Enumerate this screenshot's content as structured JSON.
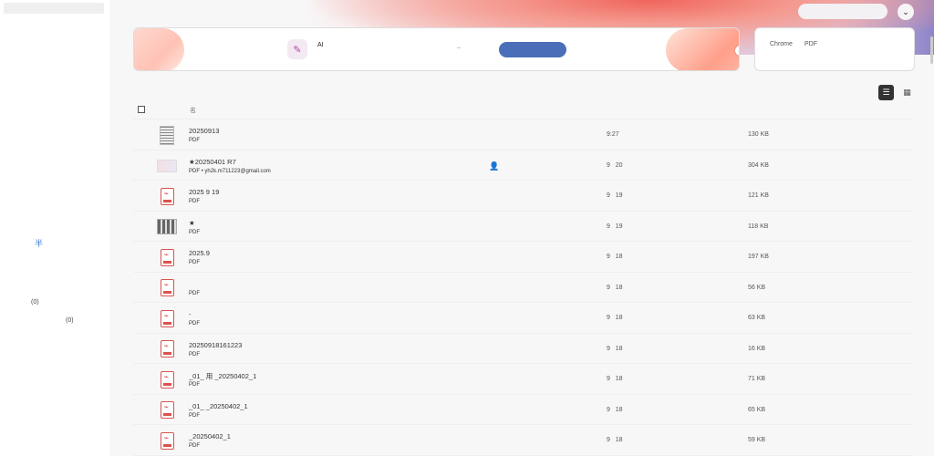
{
  "sidebar": {
    "mark": "半",
    "count1": "(0)",
    "count2": "(0)"
  },
  "header": {
    "search_placeholder": "",
    "account_icon": "chevron-down-icon"
  },
  "promo": {
    "ai_label": "AI",
    "dots": "..",
    "cta_label": "",
    "next_icon": "chevron-right-icon"
  },
  "chrome_card": {
    "label1": "Chrome",
    "label2": "PDF"
  },
  "list": {
    "name_header": "名"
  },
  "files": [
    {
      "thumb": "doc",
      "name": "20250913",
      "sub": "PDF",
      "owner": "",
      "date": "9:27",
      "size": "130 KB"
    },
    {
      "thumb": "img",
      "name": "★20250401                    R7",
      "sub": "PDF  •          yh2k.m711223@gmail.com",
      "owner": "shared",
      "date": "9   20",
      "size": "304 KB"
    },
    {
      "thumb": "pdf",
      "name": "2025    9    19",
      "sub": "PDF",
      "owner": "",
      "date": "9   19",
      "size": "121 KB"
    },
    {
      "thumb": "scan",
      "name": "★",
      "sub": "PDF",
      "owner": "",
      "date": "9   19",
      "size": "118 KB"
    },
    {
      "thumb": "pdf",
      "name": "2025.9",
      "sub": "PDF",
      "owner": "",
      "date": "9   18",
      "size": "197 KB"
    },
    {
      "thumb": "pdf",
      "name": "",
      "sub": "PDF",
      "owner": "",
      "date": "9   18",
      "size": "56 KB"
    },
    {
      "thumb": "pdf",
      "name": "                  -",
      "sub": "PDF",
      "owner": "",
      "date": "9   18",
      "size": "63 KB"
    },
    {
      "thumb": "pdf",
      "name": "20250918161223",
      "sub": "PDF",
      "owner": "",
      "date": "9   18",
      "size": "16 KB"
    },
    {
      "thumb": "pdf",
      "name": "_01_                 用        _20250402_1",
      "sub": "PDF",
      "owner": "",
      "date": "9   18",
      "size": "71 KB"
    },
    {
      "thumb": "pdf",
      "name": "_01_            _20250402_1",
      "sub": "PDF",
      "owner": "",
      "date": "9   18",
      "size": "65 KB"
    },
    {
      "thumb": "pdf",
      "name": "                                                     _20250402_1",
      "sub": "PDF",
      "owner": "",
      "date": "9   18",
      "size": "59 KB"
    }
  ]
}
